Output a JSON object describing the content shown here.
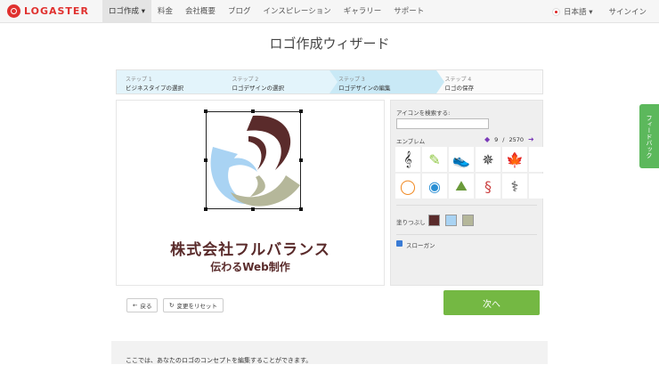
{
  "nav": {
    "brand": "LOGASTER",
    "items": [
      "ロゴ作成 ▾",
      "料金",
      "会社概要",
      "ブログ",
      "インスピレーション",
      "ギャラリー",
      "サポート"
    ],
    "language": "日本語 ▾",
    "signin": "サインイン"
  },
  "page": {
    "title": "ロゴ作成ウィザード"
  },
  "steps": [
    {
      "num": "ステップ 1",
      "label": "ビジネスタイプの選択"
    },
    {
      "num": "ステップ 2",
      "label": "ロゴデザインの選択"
    },
    {
      "num": "ステップ 3",
      "label": "ロゴデザインの編集"
    },
    {
      "num": "ステップ 4",
      "label": "ロゴの保存"
    }
  ],
  "logo": {
    "company": "株式会社フルバランス",
    "slogan": "伝わるWeb制作"
  },
  "panel": {
    "search_label": "アイコンを検索する:",
    "emblem_label": "エンブレム",
    "page_current": "9",
    "page_sep": "/",
    "page_total": "2570",
    "fill_label": "塗りつぶし",
    "slogan_label": "スローガン",
    "icons": [
      "music-clef-icon",
      "highlighter-icon",
      "sneaker-icon",
      "compass-icon",
      "maple-leaf-icon",
      "color-ring-icon",
      "wave-circle-icon",
      "mountain-lotus-icon",
      "dragon-icon",
      "caduceus-icon"
    ],
    "colors": [
      "#5a2b2b",
      "#a9d3f3",
      "#b5b79a"
    ]
  },
  "buttons": {
    "back": "戻る",
    "reset": "変更をリセット",
    "next": "次へ"
  },
  "feedback": "フィードバック",
  "info": "ここでは、あなたのロゴのコンセプトを編集することができます。"
}
